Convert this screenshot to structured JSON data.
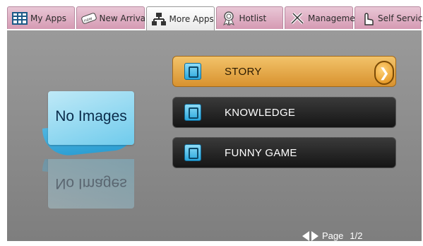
{
  "tabs": [
    {
      "label": "My Apps",
      "icon": "grid-icon",
      "active": false
    },
    {
      "label": "New Arrival",
      "icon": "new-badge-icon",
      "active": false
    },
    {
      "label": "More Apps",
      "icon": "network-icon",
      "active": true
    },
    {
      "label": "Hotlist",
      "icon": "award-icon",
      "active": false
    },
    {
      "label": "Management",
      "icon": "tools-icon",
      "active": false
    },
    {
      "label": "Self Service",
      "icon": "pointer-hand-icon",
      "active": false
    }
  ],
  "preview": {
    "text": "No Images"
  },
  "menu": [
    {
      "label": "STORY",
      "selected": true
    },
    {
      "label": "KNOWLEDGE",
      "selected": false
    },
    {
      "label": "FUNNY GAME",
      "selected": false
    }
  ],
  "pager": {
    "label": "Page",
    "current": "1/2"
  },
  "colors": {
    "selected": "#e3a544",
    "item": "#1f1f1f",
    "panel": "#8f8f8f",
    "tab": "#d9a0b8"
  }
}
